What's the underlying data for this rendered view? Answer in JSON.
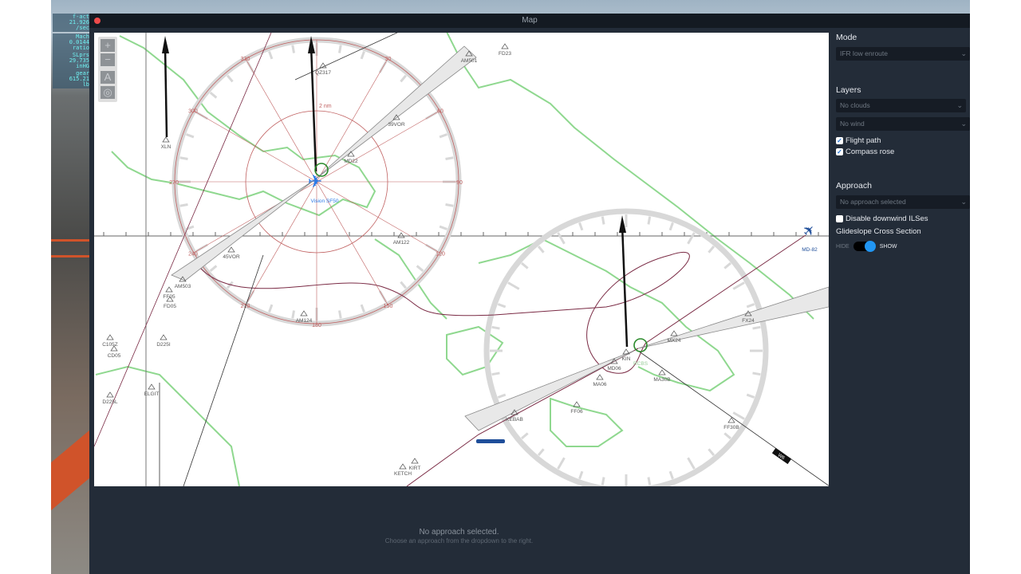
{
  "window": {
    "title": "Map"
  },
  "hud": [
    {
      "label": "f-act",
      "value": "21.926",
      "unit": "/sec"
    },
    {
      "label": "Mach",
      "value": "0.0144",
      "unit": "ratio"
    },
    {
      "label": "SLprs",
      "value": "29.735",
      "unit": "inHG"
    },
    {
      "label": "gear",
      "value": "615.21",
      "unit": "lb"
    }
  ],
  "map_controls": {
    "zoom_in": "+",
    "zoom_out": "−",
    "north_up": "A",
    "center": "◎"
  },
  "map": {
    "compass_labels": [
      "330",
      "300",
      "270",
      "240",
      "210",
      "180",
      "150",
      "120",
      "90",
      "60",
      "30"
    ],
    "range_labels": [
      "2 nm",
      "2 nm"
    ],
    "waypoints": [
      "FD23",
      "AM501",
      "QZ317",
      "39VOR",
      "XLN",
      "MD22",
      "AM122",
      "45VOR",
      "AM503",
      "FF05",
      "FD05",
      "AM124",
      "C105Z",
      "CD05",
      "D225I",
      "D225L",
      "ELGIT",
      "KIN",
      "MX24",
      "FX24",
      "MD06",
      "MA06",
      "MA30B",
      "KEBAB",
      "FF06",
      "FF30B",
      "KIRT",
      "KETCH"
    ],
    "airport_label": "RCBS",
    "airway_labels": [
      "W6"
    ],
    "aircraft": [
      {
        "label": "MD-82",
        "color": "#1f4e9a"
      },
      {
        "label": "Vision SF50",
        "color": "#2a7ae8"
      }
    ],
    "colors": {
      "coastline": "#8fd88f",
      "route": "#7a2a44",
      "range": "#c06060",
      "rose": "#d8d8d8"
    }
  },
  "panel": {
    "mode_heading": "Mode",
    "mode_value": "IFR low enroute",
    "layers_heading": "Layers",
    "clouds_value": "No clouds",
    "wind_value": "No wind",
    "flight_path": {
      "label": "Flight path",
      "checked": true
    },
    "compass_rose": {
      "label": "Compass rose",
      "checked": true
    },
    "approach_heading": "Approach",
    "approach_value": "No approach selected",
    "disable_ils": {
      "label": "Disable downwind ILSes",
      "checked": false
    },
    "glideslope_heading": "Glideslope Cross Section",
    "toggle": {
      "off": "HIDE",
      "on": "SHOW",
      "state": "SHOW"
    }
  },
  "message": {
    "primary": "No approach selected.",
    "secondary": "Choose an approach from the dropdown to the right."
  }
}
